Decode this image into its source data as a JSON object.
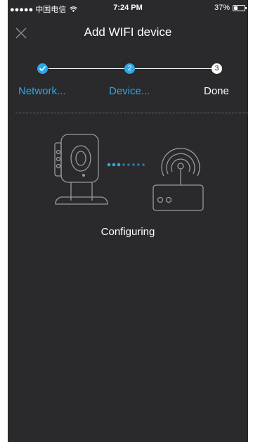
{
  "status_bar": {
    "carrier": "●●●●● 中国电信",
    "time": "7:24 PM",
    "battery_text": "37%",
    "battery_level": 0.37
  },
  "nav": {
    "title": "Add WIFI device",
    "close_icon": "close-icon"
  },
  "stepper": {
    "steps": [
      {
        "number": "1",
        "label": "Network...",
        "state": "completed",
        "icon": "check-icon"
      },
      {
        "number": "2",
        "label": "Device...",
        "state": "active"
      },
      {
        "number": "3",
        "label": "Done",
        "state": "pending"
      }
    ]
  },
  "illustration": {
    "camera_icon": "camera-icon",
    "router_icon": "router-icon",
    "progress_dots": 8,
    "active_dots": 3
  },
  "status_text": "Configuring",
  "colors": {
    "background": "#2a2a2c",
    "accent": "#2ea8e5",
    "text": "#ffffff",
    "icon_gray": "#9a9a9a",
    "dot_active": "#2ea8e5",
    "dot_inactive": "#2a7aa8"
  }
}
